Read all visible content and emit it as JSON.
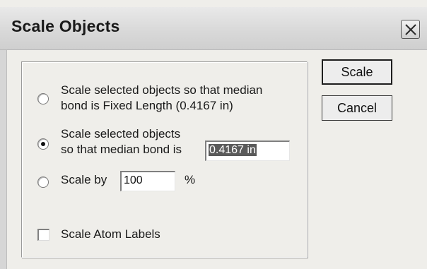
{
  "window": {
    "title": "Scale Objects"
  },
  "options": {
    "fixed_length": {
      "line1": "Scale selected objects so that median",
      "line2": "bond is Fixed Length (0.4167 in)",
      "selected": false
    },
    "median_bond": {
      "line1": "Scale selected objects",
      "line2": "so that median bond is",
      "value": "0.4167 in",
      "selected": true
    },
    "scale_by": {
      "label": "Scale by",
      "value": "100",
      "unit": "%",
      "selected": false
    }
  },
  "scale_atom_labels": {
    "label": "Scale Atom Labels",
    "checked": false
  },
  "buttons": {
    "scale": "Scale",
    "cancel": "Cancel"
  },
  "icons": {
    "close": "close-icon"
  }
}
